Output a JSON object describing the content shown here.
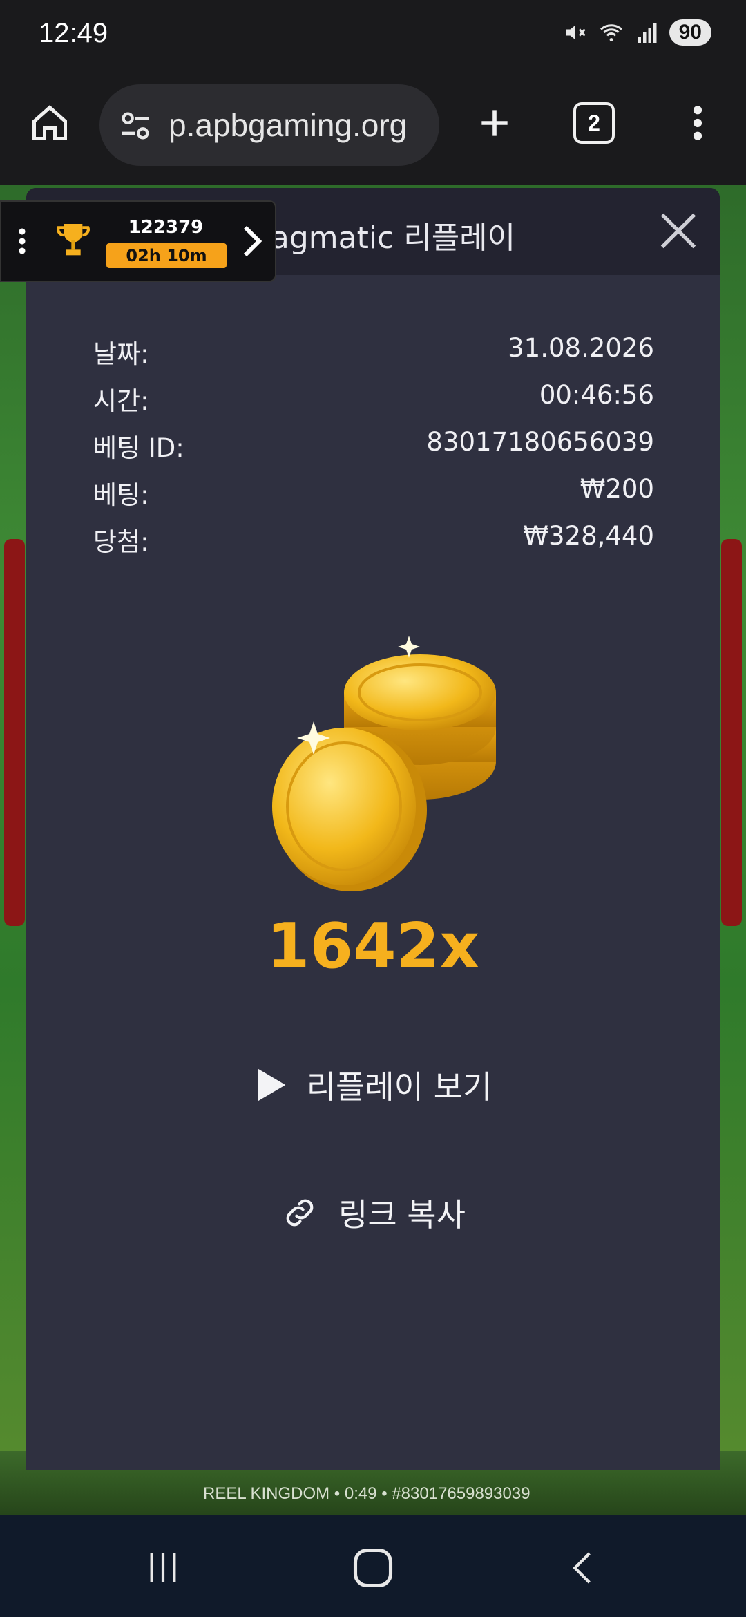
{
  "status_bar": {
    "time": "12:49",
    "battery": "90"
  },
  "browser": {
    "url": "p.apbgaming.org",
    "tab_count": "2"
  },
  "tournament": {
    "score": "122379",
    "timer": "02h 10m"
  },
  "modal": {
    "title": "Pragmatic 리플레이",
    "details": [
      {
        "label": "날짜:",
        "value": "31.08.2026"
      },
      {
        "label": "시간:",
        "value": "00:46:56"
      },
      {
        "label": "베팅 ID:",
        "value": "83017180656039"
      },
      {
        "label": "베팅:",
        "value": "₩200"
      },
      {
        "label": "당첨:",
        "value": "₩328,440"
      }
    ],
    "multiplier": "1642x",
    "watch_replay_label": "리플레이 보기",
    "copy_link_label": "링크 복사"
  },
  "game_footer": {
    "text": "REEL KINGDOM • 0:49 • #83017659893039"
  },
  "colors": {
    "modal_bg": "#2f3040",
    "header_bg": "#232330",
    "accent_gold": "#f6b01e",
    "timer_orange": "#f6a21a"
  }
}
